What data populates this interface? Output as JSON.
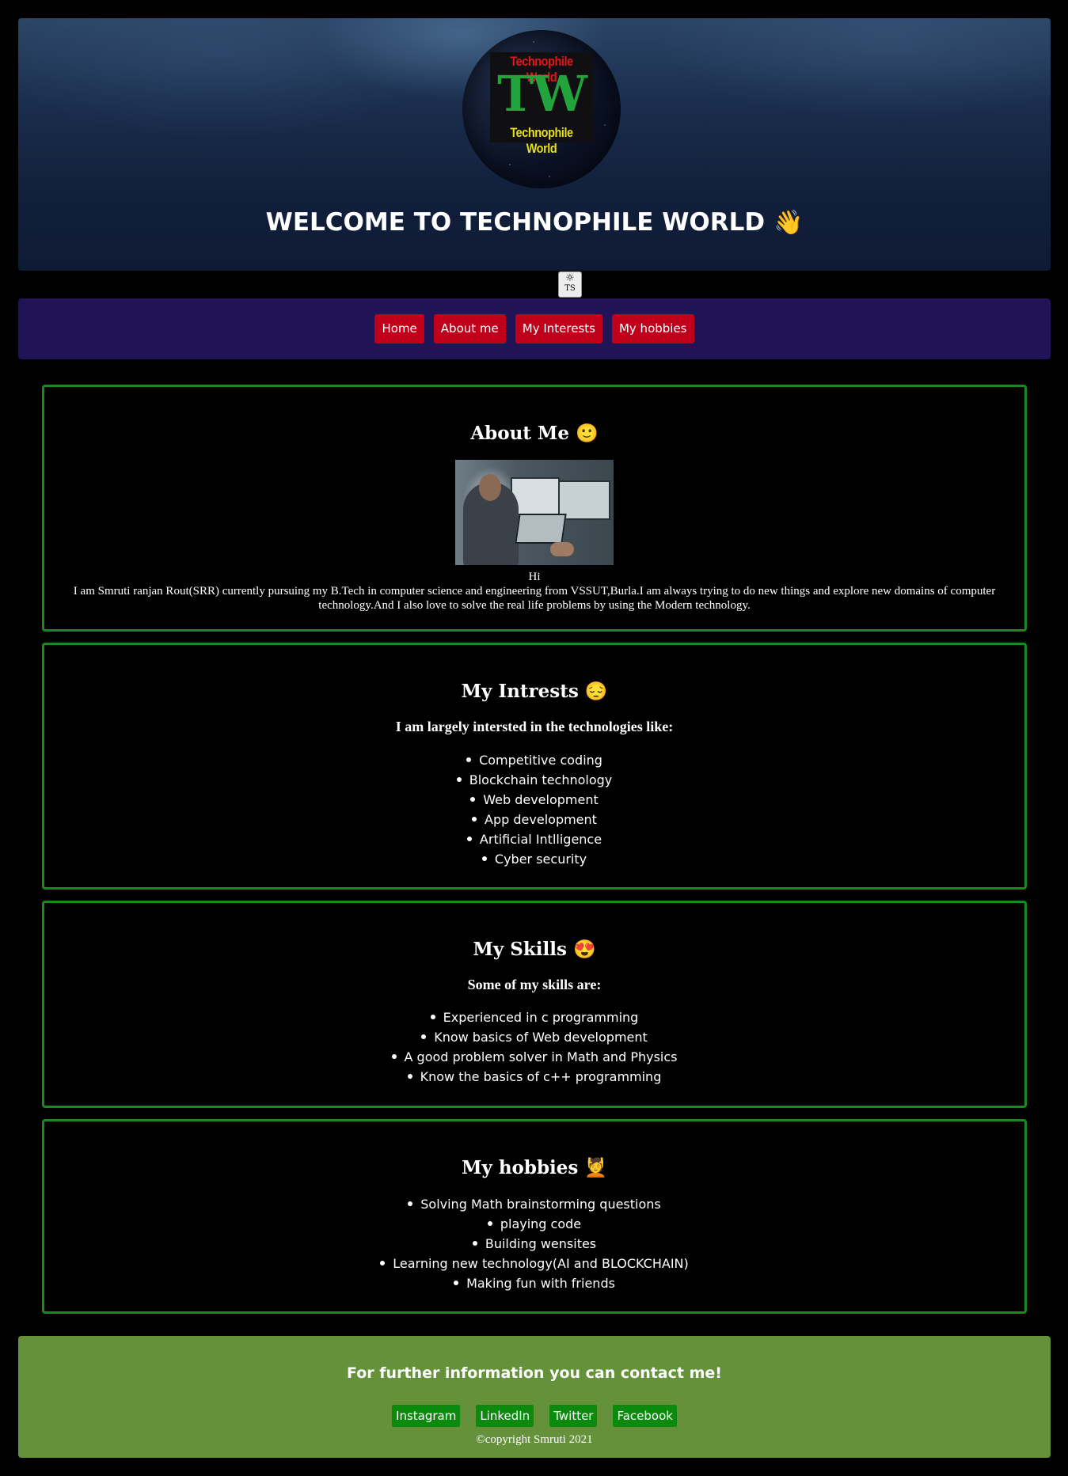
{
  "header": {
    "logo": {
      "top_text": "Technophile World",
      "monogram": "TW",
      "bottom_text": "Technophile World"
    },
    "title": "WELCOME TO TECHNOPHILE WORLD",
    "title_emoji": "👋"
  },
  "theme_toggle": {
    "icon": "sun-icon",
    "label": "TS"
  },
  "nav": {
    "items": [
      {
        "label": "Home"
      },
      {
        "label": "About me"
      },
      {
        "label": "My Interests"
      },
      {
        "label": "My hobbies"
      }
    ]
  },
  "about": {
    "heading": "About Me 🙂",
    "greeting": "Hi",
    "text": "I am Smruti ranjan Rout(SRR) currently pursuing my B.Tech in computer science and engineering from VSSUT,Burla.I am always trying to do new things and explore new domains of computer technology.And I also love to solve the real life problems by using the Modern technology."
  },
  "interests": {
    "heading": "My Intrests 😔",
    "intro": "I am largely intersted in the technologies like:",
    "items": [
      "Competitive coding",
      "Blockchain technology",
      "Web development",
      "App development",
      "Artificial Intlligence",
      "Cyber security"
    ]
  },
  "skills": {
    "heading": "My Skills 😍",
    "intro": "Some of my skills are:",
    "items": [
      "Experienced in c programming",
      "Know basics of Web development",
      "A good problem solver in Math and Physics",
      "Know the basics of c++ programming"
    ]
  },
  "hobbies": {
    "heading": "My hobbies 💆",
    "items": [
      "Solving Math brainstorming questions",
      "playing code",
      "Building wensites",
      "Learning new technology(AI and BLOCKCHAIN)",
      "Making fun with friends"
    ]
  },
  "footer": {
    "heading": "For further information you can contact me!",
    "links": [
      {
        "label": "Instagram"
      },
      {
        "label": "LinkedIn"
      },
      {
        "label": "Twitter"
      },
      {
        "label": "Facebook"
      }
    ],
    "copyright": "©copyright Smruti 2021"
  },
  "colors": {
    "nav_bg": "#211456",
    "nav_button": "#c0001a",
    "card_border": "#198a1c",
    "footer_bg": "#64913a",
    "footer_button": "#0b8a0e"
  }
}
